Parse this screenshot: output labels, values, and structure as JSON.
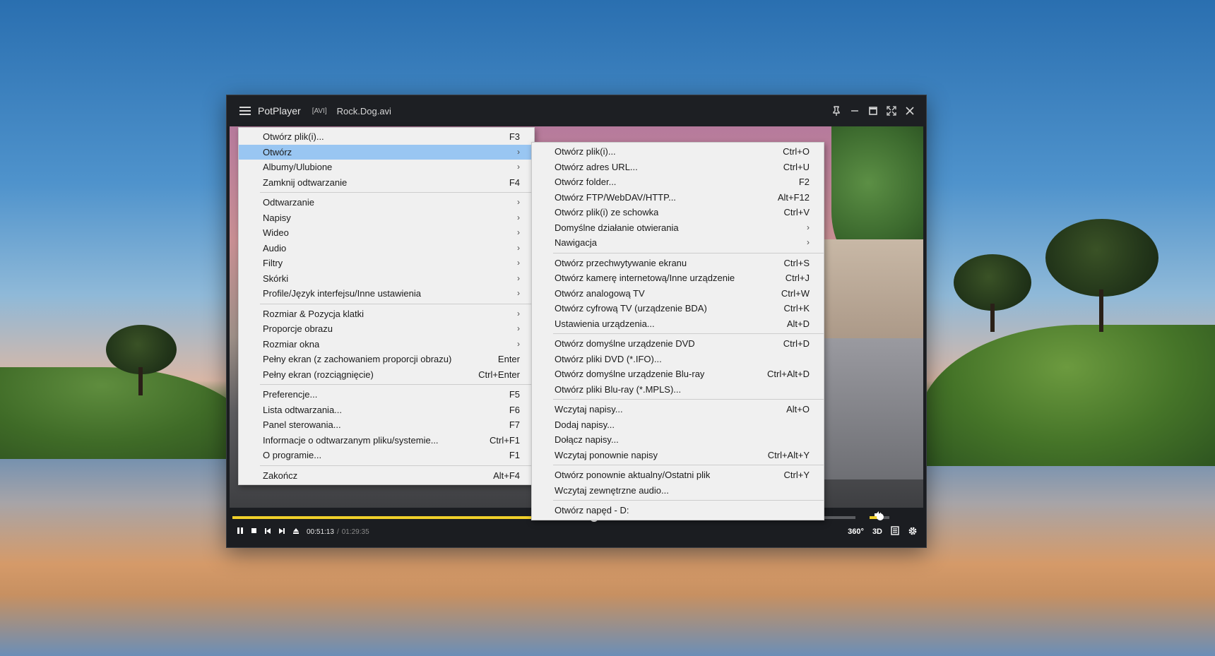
{
  "titlebar": {
    "app_title": "PotPlayer",
    "format_tag": "[AVI]",
    "file_name": "Rock.Dog.avi"
  },
  "window_controls": [
    "pin-icon",
    "minimize-icon",
    "maximize-icon",
    "fullscreen-icon",
    "close-icon"
  ],
  "playback": {
    "current_time": "00:51:13",
    "separator": "/",
    "total_time": "01:29:35",
    "progress": 0.58,
    "volume": 0.55
  },
  "controls_right": {
    "vr360": "360°",
    "mode3d": "3D"
  },
  "main_menu": {
    "items": [
      {
        "label": "Otwórz plik(i)...",
        "shortcut": "F3"
      },
      {
        "label": "Otwórz",
        "shortcut": "",
        "submenu": true,
        "active": true
      },
      {
        "label": "Albumy/Ulubione",
        "shortcut": "",
        "submenu": true
      },
      {
        "label": "Zamknij odtwarzanie",
        "shortcut": "F4"
      },
      {
        "separator": true
      },
      {
        "label": "Odtwarzanie",
        "shortcut": "",
        "submenu": true
      },
      {
        "label": "Napisy",
        "shortcut": "",
        "submenu": true
      },
      {
        "label": "Wideo",
        "shortcut": "",
        "submenu": true
      },
      {
        "label": "Audio",
        "shortcut": "",
        "submenu": true
      },
      {
        "label": "Filtry",
        "shortcut": "",
        "submenu": true
      },
      {
        "label": "Skórki",
        "shortcut": "",
        "submenu": true
      },
      {
        "label": "Profile/Język interfejsu/Inne ustawienia",
        "shortcut": "",
        "submenu": true
      },
      {
        "separator": true
      },
      {
        "label": "Rozmiar & Pozycja klatki",
        "shortcut": "",
        "submenu": true
      },
      {
        "label": "Proporcje obrazu",
        "shortcut": "",
        "submenu": true
      },
      {
        "label": "Rozmiar okna",
        "shortcut": "",
        "submenu": true
      },
      {
        "label": "Pełny ekran (z zachowaniem proporcji obrazu)",
        "shortcut": "Enter"
      },
      {
        "label": "Pełny ekran (rozciągnięcie)",
        "shortcut": "Ctrl+Enter"
      },
      {
        "separator": true
      },
      {
        "label": "Preferencje...",
        "shortcut": "F5"
      },
      {
        "label": "Lista odtwarzania...",
        "shortcut": "F6"
      },
      {
        "label": "Panel sterowania...",
        "shortcut": "F7"
      },
      {
        "label": "Informacje o odtwarzanym pliku/systemie...",
        "shortcut": "Ctrl+F1"
      },
      {
        "label": "O programie...",
        "shortcut": "F1"
      },
      {
        "separator": true
      },
      {
        "label": "Zakończ",
        "shortcut": "Alt+F4"
      }
    ]
  },
  "sub_menu": {
    "items": [
      {
        "label": "Otwórz plik(i)...",
        "shortcut": "Ctrl+O"
      },
      {
        "label": "Otwórz adres URL...",
        "shortcut": "Ctrl+U"
      },
      {
        "label": "Otwórz folder...",
        "shortcut": "F2"
      },
      {
        "label": "Otwórz FTP/WebDAV/HTTP...",
        "shortcut": "Alt+F12"
      },
      {
        "label": "Otwórz plik(i) ze schowka",
        "shortcut": "Ctrl+V"
      },
      {
        "label": "Domyślne działanie otwierania",
        "shortcut": "",
        "submenu": true
      },
      {
        "label": "Nawigacja",
        "shortcut": "",
        "submenu": true
      },
      {
        "separator": true
      },
      {
        "label": "Otwórz przechwytywanie ekranu",
        "shortcut": "Ctrl+S"
      },
      {
        "label": "Otwórz kamerę internetową/Inne urządzenie",
        "shortcut": "Ctrl+J"
      },
      {
        "label": "Otwórz analogową TV",
        "shortcut": "Ctrl+W"
      },
      {
        "label": "Otwórz cyfrową TV (urządzenie BDA)",
        "shortcut": "Ctrl+K"
      },
      {
        "label": "Ustawienia urządzenia...",
        "shortcut": "Alt+D"
      },
      {
        "separator": true
      },
      {
        "label": "Otwórz domyślne urządzenie DVD",
        "shortcut": "Ctrl+D"
      },
      {
        "label": "Otwórz pliki DVD (*.IFO)...",
        "shortcut": ""
      },
      {
        "label": "Otwórz domyślne urządzenie Blu-ray",
        "shortcut": "Ctrl+Alt+D"
      },
      {
        "label": "Otwórz pliki Blu-ray (*.MPLS)...",
        "shortcut": ""
      },
      {
        "separator": true
      },
      {
        "label": "Wczytaj napisy...",
        "shortcut": "Alt+O"
      },
      {
        "label": "Dodaj napisy...",
        "shortcut": ""
      },
      {
        "label": "Dołącz napisy...",
        "shortcut": ""
      },
      {
        "label": "Wczytaj ponownie napisy",
        "shortcut": "Ctrl+Alt+Y"
      },
      {
        "separator": true
      },
      {
        "label": "Otwórz ponownie aktualny/Ostatni plik",
        "shortcut": "Ctrl+Y"
      },
      {
        "label": "Wczytaj zewnętrzne audio...",
        "shortcut": ""
      },
      {
        "separator": true
      },
      {
        "label": "Otwórz napęd - D:",
        "shortcut": ""
      }
    ]
  },
  "colors": {
    "menu_bg": "#f0f0f0",
    "menu_highlight": "#99c6f2",
    "seek_fill": "#f0cf2a",
    "player_bg": "#1b1d21"
  }
}
